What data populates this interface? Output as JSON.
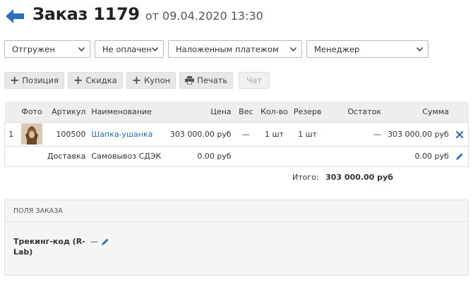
{
  "header": {
    "title": "Заказ 1179",
    "date": "от 09.04.2020 13:30"
  },
  "filters": [
    {
      "value": "Отгружен"
    },
    {
      "value": "Не оплачен"
    },
    {
      "value": "Наложенным платежом"
    },
    {
      "value": "Менеджер"
    }
  ],
  "toolbar": {
    "add_position": "Позиция",
    "add_discount": "Скидка",
    "add_coupon": "Купон",
    "print": "Печать",
    "chat": "Чат"
  },
  "table": {
    "columns": [
      "Фото",
      "Артикул",
      "Наименование",
      "Цена",
      "Вес",
      "Кол-во",
      "Резерв",
      "Остаток",
      "Сумма"
    ],
    "items": [
      {
        "num": "1",
        "article": "100500",
        "name": "Шапка-ушанка",
        "price": "303 000.00 руб",
        "weight": "—",
        "qty": "1 шт",
        "reserve": "1 шт",
        "remainder": "—",
        "sum": "303 000.00 руб"
      }
    ],
    "delivery": {
      "label": "Доставка",
      "name": "Самовывоз СДЭК",
      "price": "0.00 руб",
      "sum": "0.00 руб"
    }
  },
  "total": {
    "label": "Итого:",
    "value": "303 000.00 руб"
  },
  "order_fields": {
    "title": "ПОЛЯ ЗАКАЗА",
    "tracking_label": "Трекинг-код (R-Lab)",
    "tracking_value": "—"
  },
  "colors": {
    "accent": "#2a6db5",
    "panel": "#f5f5f5",
    "header_row": "#eeeeee"
  }
}
